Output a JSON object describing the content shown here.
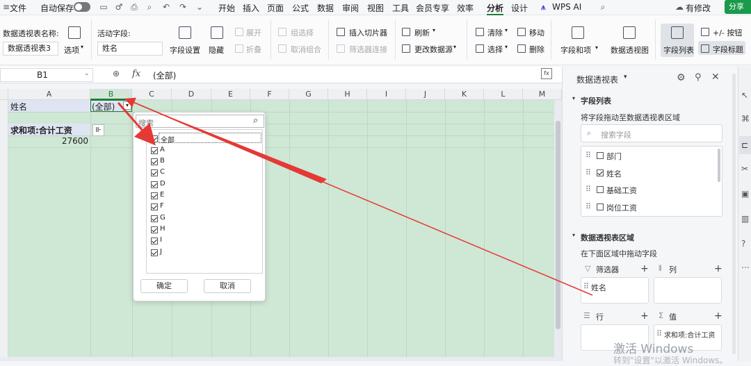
{
  "menu": {
    "file": "文件",
    "autosave": "自动保存",
    "tabs": [
      "开始",
      "插入",
      "页面",
      "公式",
      "数据",
      "审阅",
      "视图",
      "工具",
      "会员专享",
      "效率",
      "分析",
      "设计"
    ],
    "active_tab": "分析",
    "wps_ai": "WPS AI",
    "modified": "有修改",
    "share": "分享"
  },
  "ribbon": {
    "pivot_name_label": "数据透视表名称:",
    "pivot_name_value": "数据透视表3",
    "options": "选项",
    "active_field_label": "活动字段:",
    "active_field_value": "姓名",
    "field_settings": "字段设置",
    "hide": "隐藏",
    "expand": "展开",
    "collapse": "折叠",
    "group_select": "组选择",
    "ungroup": "取消组合",
    "insert_slicer": "插入切片器",
    "filter_connect": "筛选器连接",
    "refresh": "刷新",
    "change_source": "更改数据源",
    "clear": "清除",
    "select": "选择",
    "move": "移动",
    "delete": "删除",
    "fields_items": "字段和项",
    "pivot_chart": "数据透视图",
    "field_list": "字段列表",
    "plus_minus": "+/- 按钮",
    "field_header": "字段标题"
  },
  "formula_bar": {
    "cell_ref": "B1",
    "fx": "fx",
    "value": "(全部)"
  },
  "sheet": {
    "columns": [
      "A",
      "B",
      "C",
      "D",
      "E",
      "F",
      "G",
      "H",
      "I",
      "J",
      "K",
      "L",
      "M"
    ],
    "selected_column": "B",
    "a1": "姓名",
    "b1": "(全部)",
    "a3": "求和项:合计工资",
    "a4": "27600",
    "row_numbers": [
      "",
      "",
      "",
      "",
      "",
      "",
      "",
      "",
      "",
      "0",
      "1",
      "2",
      "3",
      "4",
      "5",
      "6",
      "7",
      "8",
      "9"
    ]
  },
  "dropdown": {
    "search_placeholder": "搜索",
    "items": [
      "全部",
      "A",
      "B",
      "C",
      "D",
      "E",
      "F",
      "G",
      "H",
      "I",
      "J"
    ],
    "ok": "确定",
    "cancel": "取消"
  },
  "panel": {
    "title": "数据透视表",
    "field_list_title": "字段列表",
    "field_list_hint": "将字段拖动至数据透视表区域",
    "search_fields_placeholder": "搜索字段",
    "fields": [
      {
        "label": "部门",
        "checked": false
      },
      {
        "label": "姓名",
        "checked": true
      },
      {
        "label": "基础工资",
        "checked": false
      },
      {
        "label": "岗位工资",
        "checked": false
      }
    ],
    "area_title": "数据透视表区域",
    "area_hint": "在下面区域中拖动字段",
    "filter_label": "筛选器",
    "column_label": "列",
    "row_label": "行",
    "value_label": "值",
    "filter_item": "姓名",
    "value_item": "求和项:合计工资"
  },
  "watermark": {
    "line1": "激活 Windows",
    "line2": "转到\"设置\"以激活 Windows。"
  },
  "colors": {
    "accent": "#1a7f37",
    "arrow": "#e53935",
    "grid": "#cfe7d5"
  }
}
